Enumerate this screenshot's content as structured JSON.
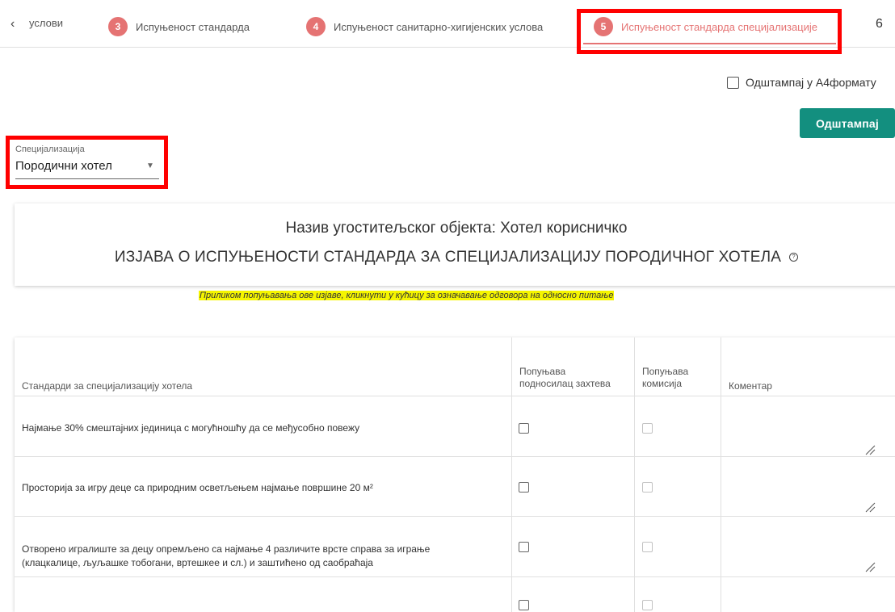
{
  "stepper": {
    "back_icon": "chevron-left-icon",
    "prev_partial_label": "услови",
    "steps": [
      {
        "number": "3",
        "label": "Испуњеност стандарда"
      },
      {
        "number": "4",
        "label": "Испуњеност санитарно-хигијенских услова"
      },
      {
        "number": "5",
        "label": "Испуњеност стандарда специјализације"
      },
      {
        "number": "6",
        "label": ""
      }
    ],
    "active_color": "#e57373",
    "inactive_number_color": "#bdbdbd"
  },
  "print": {
    "a4_label": "Одштампај у А4формату",
    "a4_checked": false,
    "button_label": "Одштампај",
    "button_color": "#138f7f"
  },
  "specialization": {
    "label": "Специјализација",
    "value": "Породични хотел"
  },
  "header": {
    "object_name": "Назив угоститељског објекта: Хотел корисничко",
    "title": "ИЗЈАВА О ИСПУЊЕНОСТИ СТАНДАРДА ЗА СПЕЦИЈАЛИЗАЦИЈУ ПОРОДИЧНОГ ХОТЕЛА",
    "help_icon": "help-circle-icon"
  },
  "hint": {
    "text": "Приликом попуњавања ове изјаве, кликнути у кућицу за означавање одговора на односно питање",
    "highlight_color": "#f5f500"
  },
  "table": {
    "headers": {
      "standard": "Стандарди за специјализацију хотела",
      "applicant": [
        "Попуњава",
        "подносилац захтева"
      ],
      "commission": [
        "Попуњава",
        "комисија"
      ],
      "comment": "Коментар"
    },
    "rows": [
      {
        "text": [
          "Најмање 30% смештајних јединица с могућношћу да се међусобно повежу"
        ],
        "applicant_checked": false,
        "commission_checked": false,
        "comment": ""
      },
      {
        "text": [
          "Просторија за игру деце са природним осветљењем најмање површине 20 м²"
        ],
        "applicant_checked": false,
        "commission_checked": false,
        "comment": ""
      },
      {
        "text": [
          "Отворено игралиште за децу опремљено са најмање 4 различите врсте справа за играње",
          "(клацкалице, љуљашке тобогани, вртешкее и сл.) и заштићено од саобраћаја"
        ],
        "applicant_checked": false,
        "commission_checked": false,
        "comment": ""
      },
      {
        "text": [],
        "applicant_checked": false,
        "commission_checked": false,
        "comment": ""
      }
    ]
  }
}
